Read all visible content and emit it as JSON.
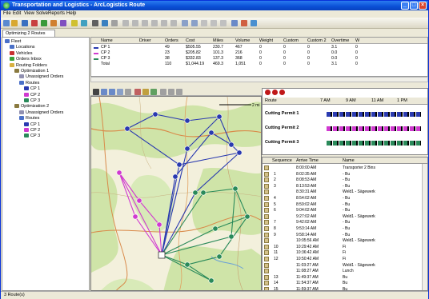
{
  "window": {
    "title": "Transportation and Logistics - ArcLogistics Route"
  },
  "menu": [
    "File",
    "Edit",
    "View",
    "Solve",
    "Reports",
    "Help"
  ],
  "toolbar_tab": "Optimizing 2 Routes",
  "tree": [
    {
      "label": "Fleet",
      "level": 0,
      "color": "#4a70c8"
    },
    {
      "label": "Locations",
      "level": 1,
      "color": "#4a70c8"
    },
    {
      "label": "Vehicles",
      "level": 1,
      "color": "#c83030"
    },
    {
      "label": "Orders Inbox",
      "level": 1,
      "color": "#38a038"
    },
    {
      "label": "Routing Folders",
      "level": 1,
      "color": "#d8b040"
    },
    {
      "label": "Optimization 1",
      "level": 2,
      "color": "#8a7a40"
    },
    {
      "label": "Unassigned Orders",
      "level": 3,
      "color": "#9090b0"
    },
    {
      "label": "Routes",
      "level": 3,
      "color": "#4a70c8"
    },
    {
      "label": "CP 1",
      "level": 4,
      "color": "#2a3ab0"
    },
    {
      "label": "CP 2",
      "level": 4,
      "color": "#d03ad0"
    },
    {
      "label": "CP 3",
      "level": 4,
      "color": "#2a8a5a"
    },
    {
      "label": "Optimization 2",
      "level": 2,
      "color": "#8a7a40"
    },
    {
      "label": "Unassigned Orders",
      "level": 3,
      "color": "#9090b0"
    },
    {
      "label": "Routes",
      "level": 3,
      "color": "#4a70c8"
    },
    {
      "label": "CP 1",
      "level": 4,
      "color": "#2a3ab0"
    },
    {
      "label": "CP 2",
      "level": 4,
      "color": "#d03ad0"
    },
    {
      "label": "CP 3",
      "level": 4,
      "color": "#2a8a5a"
    }
  ],
  "grid": {
    "headers": [
      "Name",
      "Driver",
      "Orders",
      "Cost",
      "Miles",
      "Volume",
      "Weight",
      "Custom",
      "Custom 2",
      "Overtime",
      "W"
    ],
    "rows": [
      {
        "color": "#2a3ab0",
        "cells": [
          "CP 1",
          "",
          "49",
          "$505.55",
          "230.7",
          "467",
          "0",
          "0",
          "0",
          "3.1",
          "0"
        ]
      },
      {
        "color": "#d03ad0",
        "cells": [
          "CP 2",
          "",
          "23",
          "$205.82",
          "101.3",
          "216",
          "0",
          "0",
          "0",
          "0.0",
          "0"
        ]
      },
      {
        "color": "#2a8a5a",
        "cells": [
          "CP 3",
          "",
          "38",
          "$332.83",
          "137.3",
          "368",
          "0",
          "0",
          "0",
          "0.0",
          "0"
        ]
      },
      {
        "color": "",
        "cells": [
          "Total",
          "",
          "110",
          "$1,044.19",
          "469.3",
          "1,051",
          "0",
          "0",
          "0",
          "3.1",
          "0"
        ]
      }
    ]
  },
  "map": {
    "scale_label": "2 mi"
  },
  "gantt": {
    "route_header": "Route",
    "times": [
      "7 AM",
      "9 AM",
      "11 AM",
      "1 PM"
    ],
    "routes": [
      {
        "label": "Cutting Permit 1",
        "color": "#2a3ab0"
      },
      {
        "label": "Cutting Permit 2",
        "color": "#d03ad0"
      },
      {
        "label": "Cutting Permit 3",
        "color": "#2a8a5a"
      }
    ]
  },
  "sequence": {
    "headers": [
      "Sequence",
      "Arrive Time",
      "Name"
    ],
    "rows": [
      [
        "",
        "8:00:00 AM",
        "Transporter 2 Bins"
      ],
      [
        "1",
        "8:02:35 AM",
        "- Bu"
      ],
      [
        "2",
        "8:08:53 AM",
        "- Bu"
      ],
      [
        "3",
        "8:13:53 AM",
        "- Bu"
      ],
      [
        "",
        "8:30:31 AM",
        "Weld1 - Sägewerk"
      ],
      [
        "4",
        "8:54:02 AM",
        "- Bu"
      ],
      [
        "5",
        "8:59:02 AM",
        "- Bu"
      ],
      [
        "6",
        "9:04:02 AM",
        "- Bu"
      ],
      [
        "",
        "9:27:02 AM",
        "Weld1 - Sägewerk"
      ],
      [
        "7",
        "9:42:02 AM",
        "- Bu"
      ],
      [
        "8",
        "9:53:14 AM",
        "- Bu"
      ],
      [
        "9",
        "9:58:14 AM",
        "- Bu"
      ],
      [
        "",
        "10:05:56 AM",
        "Weld1 - Sägewerk"
      ],
      [
        "10",
        "10:29:42 AM",
        "Fi"
      ],
      [
        "11",
        "10:36:42 AM",
        "Fi"
      ],
      [
        "12",
        "10:50:42 AM",
        "Fi"
      ],
      [
        "",
        "11:03:27 AM",
        "Weld1 - Sägewerk"
      ],
      [
        "",
        "11:08:27 AM",
        "Lunch"
      ],
      [
        "13",
        "11:49:37 AM",
        "Bu"
      ],
      [
        "14",
        "11:54:37 AM",
        "Bu"
      ],
      [
        "15",
        "11:59:37 AM",
        "Bu"
      ]
    ]
  },
  "status": "3 Route(s)"
}
